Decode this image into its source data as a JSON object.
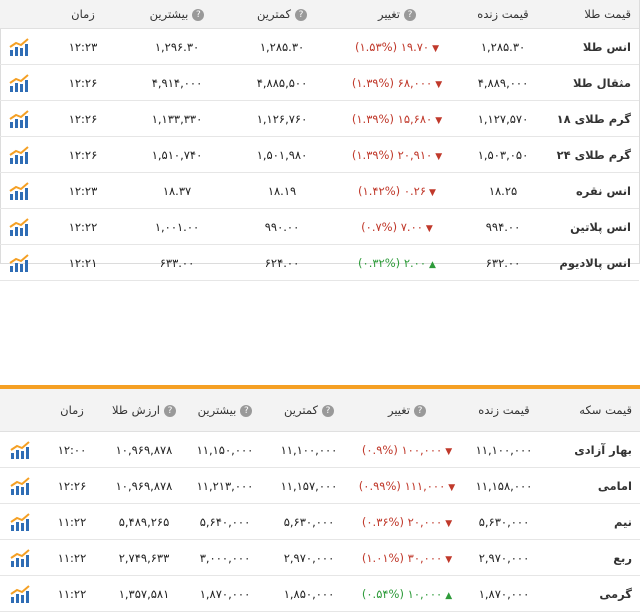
{
  "gold": {
    "headers": [
      "قیمت طلا",
      "قیمت زنده",
      "تغییر",
      "کمترین",
      "بیشترین",
      "زمان"
    ],
    "rows": [
      {
        "name": "انس طلا",
        "price": "۱,۲۸۵.۳۰",
        "change": "۱۹.۷۰ (۱.۵۳%)",
        "dir": "down",
        "low": "۱,۲۸۵.۳۰",
        "high": "۱,۲۹۶.۳۰",
        "time": "۱۲:۲۳"
      },
      {
        "name": "مثقال طلا",
        "price": "۴,۸۸۹,۰۰۰",
        "change": "۶۸,۰۰۰ (۱.۳۹%)",
        "dir": "down",
        "low": "۴,۸۸۵,۵۰۰",
        "high": "۴,۹۱۴,۰۰۰",
        "time": "۱۲:۲۶"
      },
      {
        "name": "گرم طلای ۱۸",
        "price": "۱,۱۲۷,۵۷۰",
        "change": "۱۵,۶۸۰ (۱.۳۹%)",
        "dir": "down",
        "low": "۱,۱۲۶,۷۶۰",
        "high": "۱,۱۳۳,۳۳۰",
        "time": "۱۲:۲۶"
      },
      {
        "name": "گرم طلای ۲۴",
        "price": "۱,۵۰۳,۰۵۰",
        "change": "۲۰,۹۱۰ (۱.۳۹%)",
        "dir": "down",
        "low": "۱,۵۰۱,۹۸۰",
        "high": "۱,۵۱۰,۷۴۰",
        "time": "۱۲:۲۶"
      },
      {
        "name": "انس نقره",
        "price": "۱۸.۲۵",
        "change": "۰.۲۶ (۱.۴۲%)",
        "dir": "down",
        "low": "۱۸.۱۹",
        "high": "۱۸.۳۷",
        "time": "۱۲:۲۳"
      },
      {
        "name": "انس پلاتین",
        "price": "۹۹۴.۰۰",
        "change": "۷.۰۰ (۰.۷%)",
        "dir": "down",
        "low": "۹۹۰.۰۰",
        "high": "۱,۰۰۱.۰۰",
        "time": "۱۲:۲۲"
      },
      {
        "name": "انس پالادیوم",
        "price": "۶۳۲.۰۰",
        "change": "۲.۰۰ (۰.۳۲%)",
        "dir": "up",
        "low": "۶۲۴.۰۰",
        "high": "۶۳۳.۰۰",
        "time": "۱۲:۲۱"
      }
    ]
  },
  "coin": {
    "headers": [
      "قیمت سکه",
      "قیمت زنده",
      "تغییر",
      "کمترین",
      "بیشترین",
      "ارزش طلا",
      "زمان"
    ],
    "rows": [
      {
        "name": "بهار آزادی",
        "price": "۱۱,۱۰۰,۰۰۰",
        "change": "۱۰۰,۰۰۰ (۰.۹%)",
        "dir": "down",
        "low": "۱۱,۱۰۰,۰۰۰",
        "high": "۱۱,۱۵۰,۰۰۰",
        "value": "۱۰,۹۶۹,۸۷۸",
        "time": "۱۲:۰۰"
      },
      {
        "name": "امامی",
        "price": "۱۱,۱۵۸,۰۰۰",
        "change": "۱۱۱,۰۰۰ (۰.۹۹%)",
        "dir": "down",
        "low": "۱۱,۱۵۷,۰۰۰",
        "high": "۱۱,۲۱۳,۰۰۰",
        "value": "۱۰,۹۶۹,۸۷۸",
        "time": "۱۲:۲۶"
      },
      {
        "name": "نیم",
        "price": "۵,۶۳۰,۰۰۰",
        "change": "۲۰,۰۰۰ (۰.۳۶%)",
        "dir": "down",
        "low": "۵,۶۳۰,۰۰۰",
        "high": "۵,۶۴۰,۰۰۰",
        "value": "۵,۴۸۹,۲۶۵",
        "time": "۱۱:۲۲"
      },
      {
        "name": "ربع",
        "price": "۲,۹۷۰,۰۰۰",
        "change": "۳۰,۰۰۰ (۱.۰۱%)",
        "dir": "down",
        "low": "۲,۹۷۰,۰۰۰",
        "high": "۳,۰۰۰,۰۰۰",
        "value": "۲,۷۴۹,۶۳۳",
        "time": "۱۱:۲۲"
      },
      {
        "name": "گرمی",
        "price": "۱,۸۷۰,۰۰۰",
        "change": "۱۰,۰۰۰ (۰.۵۴%)",
        "dir": "up",
        "low": "۱,۸۵۰,۰۰۰",
        "high": "۱,۸۷۰,۰۰۰",
        "value": "۱,۳۵۷,۵۸۱",
        "time": "۱۱:۲۲"
      }
    ]
  },
  "colors": {
    "accent": "#f5a024",
    "negative": "#c0392b",
    "positive": "#2e9b3a",
    "chart_bar": "#2f6db5",
    "chart_line": "#f5a024"
  },
  "icons": {
    "help": "question-mark-icon",
    "chart": "bar-chart-icon",
    "down": "triangle-down-icon",
    "up": "triangle-up-icon"
  }
}
